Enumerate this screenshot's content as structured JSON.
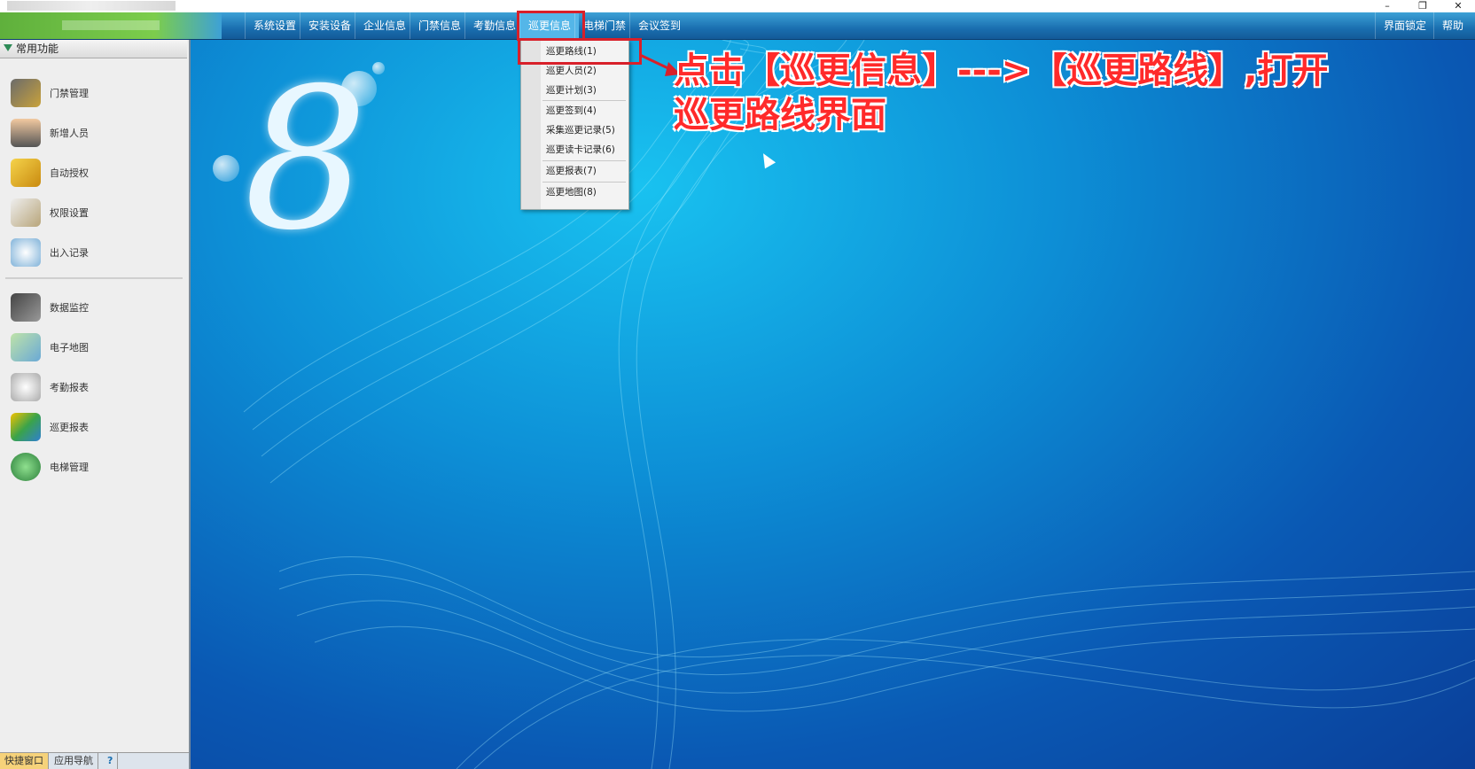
{
  "menubar": {
    "items": [
      "系统设置",
      "安装设备",
      "企业信息",
      "门禁信息",
      "考勤信息",
      "巡更信息",
      "电梯门禁",
      "会议签到"
    ],
    "right": [
      "界面锁定",
      "帮助"
    ]
  },
  "sidebar": {
    "header": "常用功能",
    "items": [
      "门禁管理",
      "新增人员",
      "自动授权",
      "权限设置",
      "出入记录",
      "数据监控",
      "电子地图",
      "考勤报表",
      "巡更报表",
      "电梯管理"
    ],
    "bottom_tabs": [
      "快捷窗口",
      "应用导航",
      "?"
    ]
  },
  "dropdown": {
    "items": [
      "巡更路线(1)",
      "巡更人员(2)",
      "巡更计划(3)",
      "巡更签到(4)",
      "采集巡更记录(5)",
      "巡更读卡记录(6)",
      "巡更报表(7)",
      "巡更地图(8)"
    ]
  },
  "annotation": {
    "line1": "点击【巡更信息】--->【巡更路线】,打开",
    "line2": "巡更路线界面"
  },
  "desktop": {
    "logo": "8"
  },
  "colors": {
    "accent_red": "#d8202a",
    "menubar": "#1a6fb0"
  }
}
